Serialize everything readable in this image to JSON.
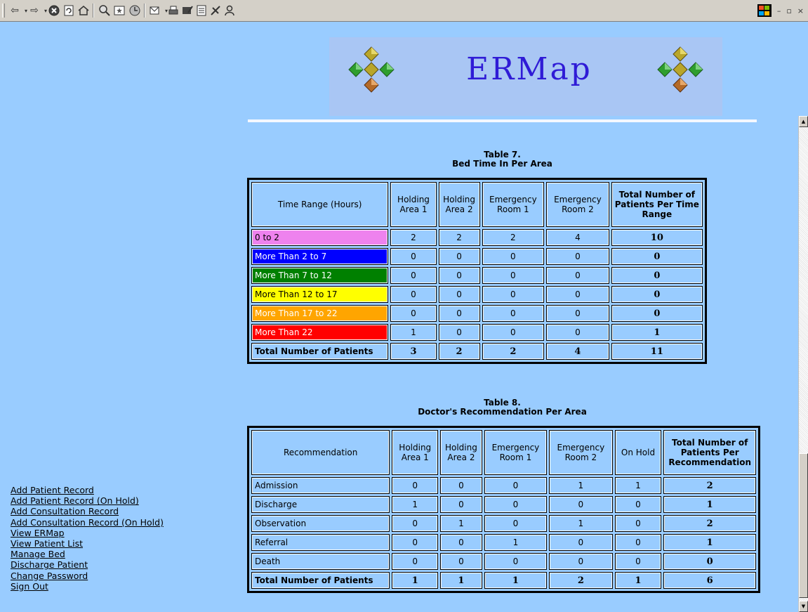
{
  "window": {
    "controls": [
      "–",
      "▫",
      "×"
    ]
  },
  "banner": {
    "title": "ERMap"
  },
  "table7": {
    "caption_line1": "Table 7.",
    "caption_line2": "Bed Time In Per Area",
    "headers": [
      "Time Range (Hours)",
      "Holding Area 1",
      "Holding Area 2",
      "Emergency Room 1",
      "Emergency Room 2",
      "Total Number of Patients Per Time Range"
    ],
    "rows": [
      {
        "label": "0 to 2",
        "color": "#ee82ee",
        "text_color": "#000000",
        "values": [
          "2",
          "2",
          "2",
          "4",
          "10"
        ]
      },
      {
        "label": "More Than 2 to 7",
        "color": "#0000ff",
        "text_color": "#ffffff",
        "values": [
          "0",
          "0",
          "0",
          "0",
          "0"
        ]
      },
      {
        "label": "More Than 7 to 12",
        "color": "#008000",
        "text_color": "#ffffff",
        "values": [
          "0",
          "0",
          "0",
          "0",
          "0"
        ]
      },
      {
        "label": "More Than 12 to 17",
        "color": "#ffff00",
        "text_color": "#000000",
        "values": [
          "0",
          "0",
          "0",
          "0",
          "0"
        ]
      },
      {
        "label": "More Than 17 to 22",
        "color": "#ffa500",
        "text_color": "#ffffff",
        "values": [
          "0",
          "0",
          "0",
          "0",
          "0"
        ]
      },
      {
        "label": "More Than 22",
        "color": "#ff0000",
        "text_color": "#ffffff",
        "values": [
          "1",
          "0",
          "0",
          "0",
          "1"
        ]
      }
    ],
    "total_row": {
      "label": "Total Number of Patients",
      "values": [
        "3",
        "2",
        "2",
        "4",
        "11"
      ]
    }
  },
  "table8": {
    "caption_line1": "Table 8.",
    "caption_line2": "Doctor's Recommendation Per Area",
    "headers": [
      "Recommendation",
      "Holding Area 1",
      "Holding Area 2",
      "Emergency Room 1",
      "Emergency Room 2",
      "On Hold",
      "Total Number of Patients Per Recommendation"
    ],
    "rows": [
      {
        "label": "Admission",
        "values": [
          "0",
          "0",
          "0",
          "1",
          "1",
          "2"
        ]
      },
      {
        "label": "Discharge",
        "values": [
          "1",
          "0",
          "0",
          "0",
          "0",
          "1"
        ]
      },
      {
        "label": "Observation",
        "values": [
          "0",
          "1",
          "0",
          "1",
          "0",
          "2"
        ]
      },
      {
        "label": "Referral",
        "values": [
          "0",
          "0",
          "1",
          "0",
          "0",
          "1"
        ]
      },
      {
        "label": "Death",
        "values": [
          "0",
          "0",
          "0",
          "0",
          "0",
          "0"
        ]
      }
    ],
    "total_row": {
      "label": "Total Number of Patients",
      "values": [
        "1",
        "1",
        "1",
        "2",
        "1",
        "6"
      ]
    }
  },
  "sidebar": {
    "links": [
      "Add Patient Record",
      "Add Patient Record (On Hold)",
      "Add Consultation Record",
      "Add Consultation Record (On Hold)",
      "View ERMap",
      "View Patient List",
      "Manage Bed",
      "Discharge Patient",
      "Change Password",
      "Sign Out"
    ]
  }
}
